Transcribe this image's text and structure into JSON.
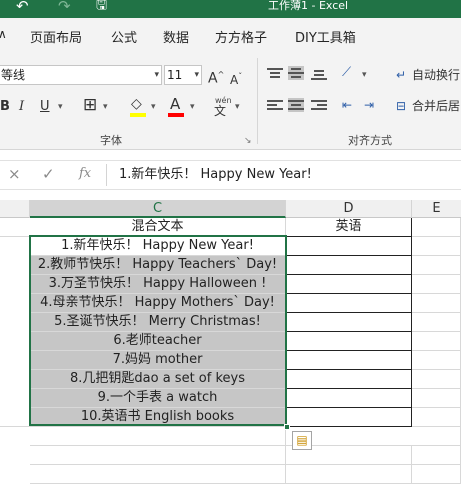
{
  "window": {
    "title": "工作薄1 - Excel",
    "quick_access": {
      "undo_glyph": "↶",
      "redo_glyph": "↷",
      "save_glyph": "🖫"
    }
  },
  "ribbon_tabs": [
    "页面布局",
    "公式",
    "数据",
    "方方格子",
    "DIY工具箱"
  ],
  "font_group": {
    "font_name": "等线",
    "font_size": "11",
    "grow_label": "A",
    "shrink_label": "A",
    "bold": "B",
    "italic": "I",
    "underline": "U",
    "font_color_label": "A",
    "phonetic_label": "wén",
    "label": "字体"
  },
  "alignment_group": {
    "wrap_text_label": "自动换行",
    "merge_center_label": "合并后居",
    "label": "对齐方式"
  },
  "formula_bar": {
    "cancel_glyph": "×",
    "enter_glyph": "✓",
    "fx_label": "fx",
    "content": "1.新年快乐！ Happy New Year!"
  },
  "columns": [
    {
      "name": "C",
      "active": true
    },
    {
      "name": "D",
      "active": false
    },
    {
      "name": "E",
      "active": false
    }
  ],
  "sheet": {
    "header_c": "混合文本",
    "header_d": "英语",
    "rows": [
      "1.新年快乐！ Happy New Year!",
      "2.教师节快乐！ Happy Teachers` Day!",
      "3.万圣节快乐！ Happy Halloween !",
      "4.母亲节快乐！ Happy Mothers` Day!",
      "5.圣诞节快乐！ Merry Christmas!",
      "6.老师teacher",
      "7.妈妈 mother",
      "8.几把钥匙dao a set of keys",
      "9.一个手表 a watch",
      "10.英语书 English books"
    ]
  },
  "colors": {
    "title_bar": "#217346",
    "selection_border": "#217346",
    "selected_cell_fill": "#c6c6c6",
    "highlight_yellow": "#ffff00",
    "font_red": "#ff0000"
  }
}
